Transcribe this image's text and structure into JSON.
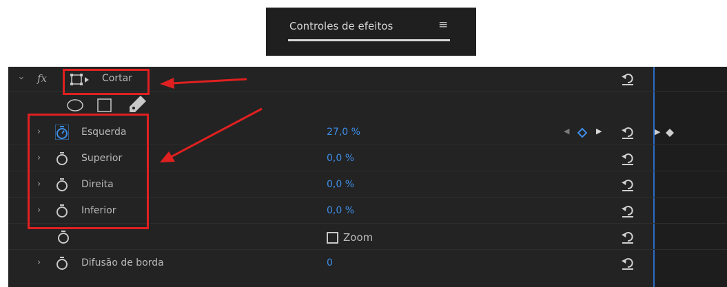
{
  "tab": {
    "title": "Controles de efeitos",
    "menu_icon": "hamburger-icon"
  },
  "effect": {
    "fx": "fx",
    "name": "Cortar"
  },
  "properties": [
    {
      "name": "Esquerda",
      "value": "27,0 %",
      "animated": true
    },
    {
      "name": "Superior",
      "value": "0,0 %",
      "animated": false
    },
    {
      "name": "Direita",
      "value": "0,0 %",
      "animated": false
    },
    {
      "name": "Inferior",
      "value": "0,0 %",
      "animated": false
    }
  ],
  "zoom": {
    "label": "Zoom",
    "checked": false
  },
  "edge": {
    "name": "Difusão de borda",
    "value": "0"
  },
  "colors": {
    "accent": "#3d8ee8",
    "highlight": "#e02020",
    "panel": "#232323"
  }
}
